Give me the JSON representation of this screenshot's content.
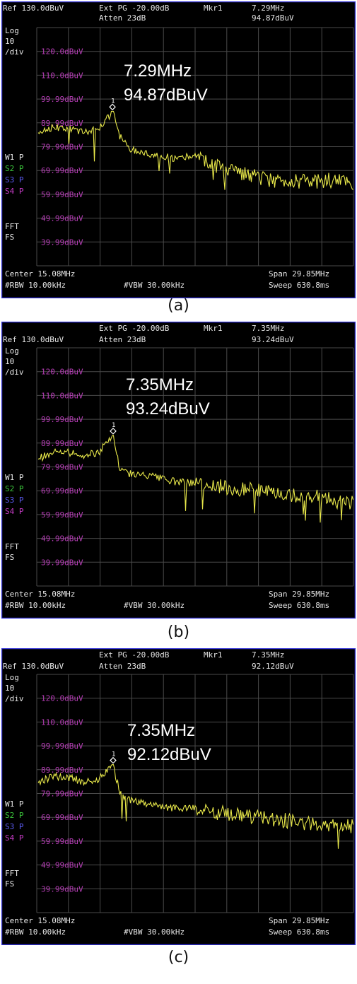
{
  "colors": {
    "background": "#000000",
    "frame": "#2f2fd6",
    "grid": "#4a4a4a",
    "text": "#e6e6e6",
    "level": "#b43cb4",
    "trace": "#e8e84a",
    "s2": "#3cc83c",
    "s3": "#5a5af0",
    "s4": "#c83cc8",
    "annotation": "#ffffff"
  },
  "panels": [
    {
      "header": {
        "ref": "Ref 130.0dBuV",
        "extpg": "Ext PG -20.00dB",
        "atten": "Atten 23dB",
        "mkr_label": "Mkr1",
        "mkr_freq": "7.29MHz",
        "mkr_amp": "94.87dBuV"
      },
      "side": {
        "log": "Log",
        "ten": "10",
        "div": "/div",
        "w1": "W1 P",
        "s2": "S2 P",
        "s3": "S3 P",
        "s4": "S4 P",
        "fft": "FFT",
        "fs": "FS"
      },
      "levels": [
        "120.0dBuV",
        "110.0dBuV",
        "99.99dBuV",
        "89.99dBuV",
        "79.99dBuV",
        "69.99dBuV",
        "59.99dBuV",
        "49.99dBuV",
        "39.99dBuV"
      ],
      "footer": {
        "center": "Center 15.08MHz",
        "span": "Span 29.85MHz",
        "rbw": "#RBW 10.00kHz",
        "vbw": "#VBW 30.00kHz",
        "sweep": "Sweep 630.8ms"
      },
      "annotation": {
        "freq": "7.29MHz",
        "amp": "94.87dBuV"
      },
      "marker_label": "1",
      "caption": "(a)"
    },
    {
      "header": {
        "ref": "Ref 130.0dBuV",
        "extpg": "Ext PG -20.00dB",
        "atten": "Atten 23dB",
        "mkr_label": "Mkr1",
        "mkr_freq": "7.35MHz",
        "mkr_amp": "93.24dBuV"
      },
      "side": {
        "log": "Log",
        "ten": "10",
        "div": "/div",
        "w1": "W1 P",
        "s2": "S2 P",
        "s3": "S3 P",
        "s4": "S4 P",
        "fft": "FFT",
        "fs": "FS"
      },
      "levels": [
        "120.0dBuV",
        "110.0dBuV",
        "99.99dBuV",
        "89.99dBuV",
        "79.99dBuV",
        "69.99dBuV",
        "59.99dBuV",
        "49.99dBuV",
        "39.99dBuV"
      ],
      "footer": {
        "center": "Center 15.08MHz",
        "span": "Span 29.85MHz",
        "rbw": "#RBW 10.00kHz",
        "vbw": "#VBW 30.00kHz",
        "sweep": "Sweep 630.8ms"
      },
      "annotation": {
        "freq": "7.35MHz",
        "amp": "93.24dBuV"
      },
      "marker_label": "1",
      "caption": "(b)"
    },
    {
      "header": {
        "ref": "Ref 130.0dBuV",
        "extpg": "Ext PG -20.00dB",
        "atten": "Atten 23dB",
        "mkr_label": "Mkr1",
        "mkr_freq": "7.35MHz",
        "mkr_amp": "92.12dBuV"
      },
      "side": {
        "log": "Log",
        "ten": "10",
        "div": "/div",
        "w1": "W1 P",
        "s2": "S2 P",
        "s3": "S3 P",
        "s4": "S4 P",
        "fft": "FFT",
        "fs": "FS"
      },
      "levels": [
        "120.0dBuV",
        "110.0dBuV",
        "99.99dBuV",
        "89.99dBuV",
        "79.99dBuV",
        "69.99dBuV",
        "59.99dBuV",
        "49.99dBuV",
        "39.99dBuV"
      ],
      "footer": {
        "center": "Center 15.08MHz",
        "span": "Span 29.85MHz",
        "rbw": "#RBW 10.00kHz",
        "vbw": "#VBW 30.00kHz",
        "sweep": "Sweep 630.8ms"
      },
      "annotation": {
        "freq": "7.35MHz",
        "amp": "92.12dBuV"
      },
      "marker_label": "1",
      "caption": "(c)"
    }
  ],
  "chart_data": [
    {
      "type": "line",
      "title": "",
      "xlabel": "",
      "ylabel": "",
      "xlim": [
        0.155,
        30.005
      ],
      "ylim": [
        30,
        130
      ],
      "grid": true,
      "yscale": "log 10 dB/div",
      "series": [
        {
          "x": [
            0.16,
            1.5,
            3.0,
            4.5,
            6.0,
            7.29,
            8.0,
            9.0,
            11.0,
            13.0,
            15.0,
            16.5,
            18.0,
            20.0,
            22.0,
            24.0,
            26.0,
            28.0,
            30.0
          ],
          "values": [
            86,
            88,
            88,
            86,
            87,
            94.87,
            84,
            79,
            77,
            75,
            76,
            73,
            70,
            68,
            66,
            66,
            65,
            66,
            65
          ]
        }
      ],
      "marker": {
        "x": 7.29,
        "y": 94.87
      }
    },
    {
      "type": "line",
      "title": "",
      "xlabel": "",
      "ylabel": "",
      "xlim": [
        0.155,
        30.005
      ],
      "ylim": [
        30,
        130
      ],
      "grid": true,
      "yscale": "log 10 dB/div",
      "series": [
        {
          "x": [
            0.16,
            1.5,
            3.0,
            4.5,
            6.0,
            7.35,
            8.0,
            9.0,
            11.0,
            13.0,
            15.0,
            17.0,
            19.0,
            21.0,
            23.0,
            25.0,
            27.0,
            29.0,
            30.0
          ],
          "values": [
            83,
            86,
            86,
            85,
            86,
            93.24,
            79,
            77,
            76,
            74,
            73,
            72,
            71,
            70,
            69,
            68,
            67,
            65,
            65
          ]
        }
      ],
      "marker": {
        "x": 7.35,
        "y": 93.24
      }
    },
    {
      "type": "line",
      "title": "",
      "xlabel": "",
      "ylabel": "",
      "xlim": [
        0.155,
        30.005
      ],
      "ylim": [
        30,
        130
      ],
      "grid": true,
      "yscale": "log 10 dB/div",
      "series": [
        {
          "x": [
            0.16,
            1.5,
            3.0,
            4.5,
            6.0,
            7.35,
            8.0,
            9.0,
            11.0,
            13.0,
            15.0,
            17.0,
            19.0,
            21.0,
            23.0,
            25.0,
            27.0,
            29.0,
            30.0
          ],
          "values": [
            84,
            87,
            87,
            85,
            86,
            92.12,
            80,
            77,
            75,
            74,
            74,
            72,
            71,
            70,
            69,
            68,
            67,
            66,
            66
          ]
        }
      ],
      "marker": {
        "x": 7.35,
        "y": 92.12
      }
    }
  ]
}
